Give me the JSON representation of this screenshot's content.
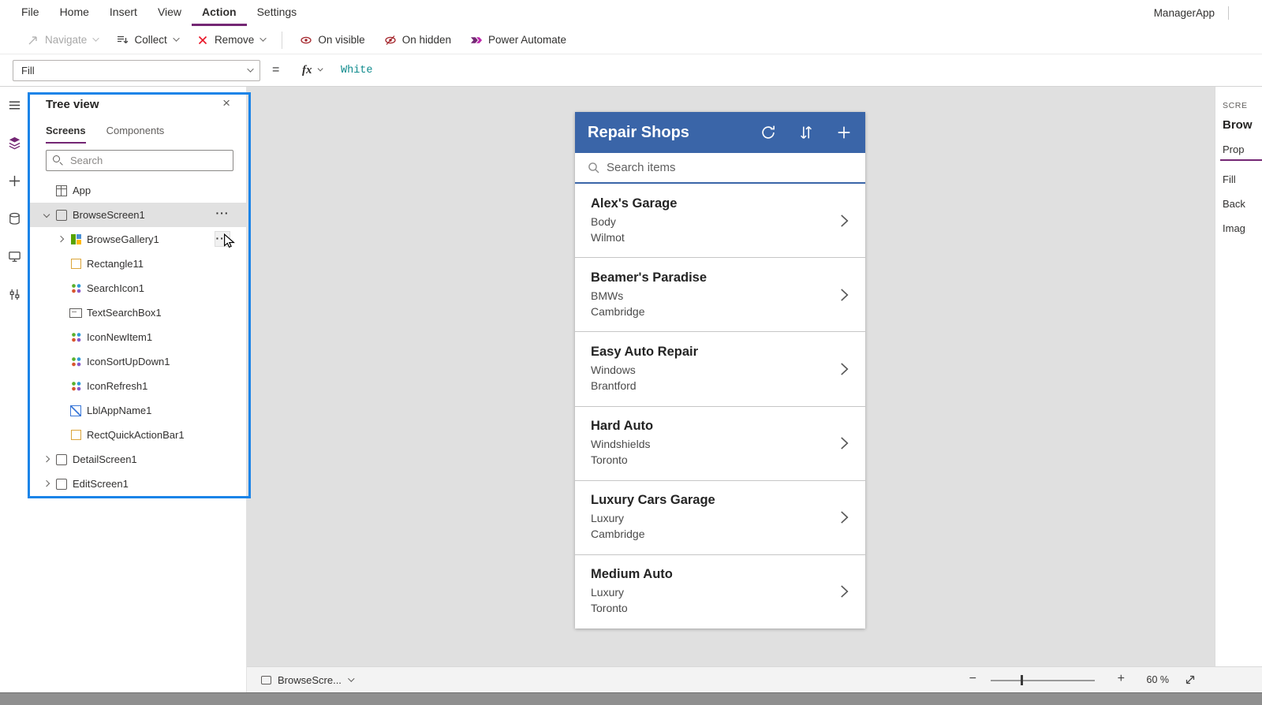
{
  "colors": {
    "brand_purple": "#742774",
    "highlight_blue": "#1b84e8",
    "app_header_blue": "#3a65a8",
    "formula_text_teal": "#0f8b8d",
    "remove_red": "#e81123"
  },
  "menubar": {
    "items": [
      {
        "label": "File"
      },
      {
        "label": "Home"
      },
      {
        "label": "Insert"
      },
      {
        "label": "View"
      },
      {
        "label": "Action",
        "classes": "active"
      },
      {
        "label": "Settings"
      }
    ],
    "app_name": "ManagerApp"
  },
  "toolbar": {
    "navigate_label": "Navigate",
    "collect_label": "Collect",
    "remove_label": "Remove",
    "on_visible_label": "On visible",
    "on_hidden_label": "On hidden",
    "power_automate_label": "Power Automate"
  },
  "formula_bar": {
    "property_selector": "Fill",
    "equals_sign": "=",
    "fx_label": "fx",
    "formula_value": "White"
  },
  "tree_panel": {
    "title": "Tree view",
    "tabs": [
      {
        "label": "Screens",
        "classes": "active"
      },
      {
        "label": "Components"
      }
    ],
    "search_placeholder": "Search",
    "items": [
      {
        "label": "App",
        "icon": "app",
        "classes": "lvl0 no-chev"
      },
      {
        "label": "BrowseScreen1",
        "icon": "screen",
        "classes": "lvl0 chev-down selected"
      },
      {
        "label": "BrowseGallery1",
        "icon": "gallery",
        "classes": "lvl1 chev-right hovered"
      },
      {
        "label": "Rectangle11",
        "icon": "rect",
        "classes": "lvl1 no-chev"
      },
      {
        "label": "SearchIcon1",
        "icon": "glyph",
        "classes": "lvl1 no-chev"
      },
      {
        "label": "TextSearchBox1",
        "icon": "textbox",
        "classes": "lvl1 no-chev"
      },
      {
        "label": "IconNewItem1",
        "icon": "glyph",
        "classes": "lvl1 no-chev"
      },
      {
        "label": "IconSortUpDown1",
        "icon": "glyph",
        "classes": "lvl1 no-chev"
      },
      {
        "label": "IconRefresh1",
        "icon": "glyph",
        "classes": "lvl1 no-chev"
      },
      {
        "label": "LblAppName1",
        "icon": "label",
        "classes": "lvl1 no-chev"
      },
      {
        "label": "RectQuickActionBar1",
        "icon": "rect",
        "classes": "lvl1 no-chev"
      },
      {
        "label": "DetailScreen1",
        "icon": "screen",
        "classes": "lvl0 chev-right"
      },
      {
        "label": "EditScreen1",
        "icon": "screen",
        "classes": "lvl0 chev-right"
      }
    ]
  },
  "phone": {
    "title": "Repair Shops",
    "search_placeholder": "Search items",
    "items": [
      {
        "name": "Alex's Garage",
        "category": "Body",
        "city": "Wilmot"
      },
      {
        "name": "Beamer's Paradise",
        "category": "BMWs",
        "city": "Cambridge"
      },
      {
        "name": "Easy Auto Repair",
        "category": "Windows",
        "city": "Brantford"
      },
      {
        "name": "Hard Auto",
        "category": "Windshields",
        "city": "Toronto"
      },
      {
        "name": "Luxury Cars Garage",
        "category": "Luxury",
        "city": "Cambridge"
      },
      {
        "name": "Medium Auto",
        "category": "Luxury",
        "city": "Toronto"
      }
    ]
  },
  "right_panel": {
    "overline": "SCRE",
    "screen_name": "Brow",
    "tab_label": "Prop",
    "fields": [
      {
        "label": "Fill"
      },
      {
        "label": "Back"
      },
      {
        "label": "Imag"
      }
    ]
  },
  "status_bar": {
    "screen_selector": "BrowseScre...",
    "zoom_value": "60 %"
  }
}
